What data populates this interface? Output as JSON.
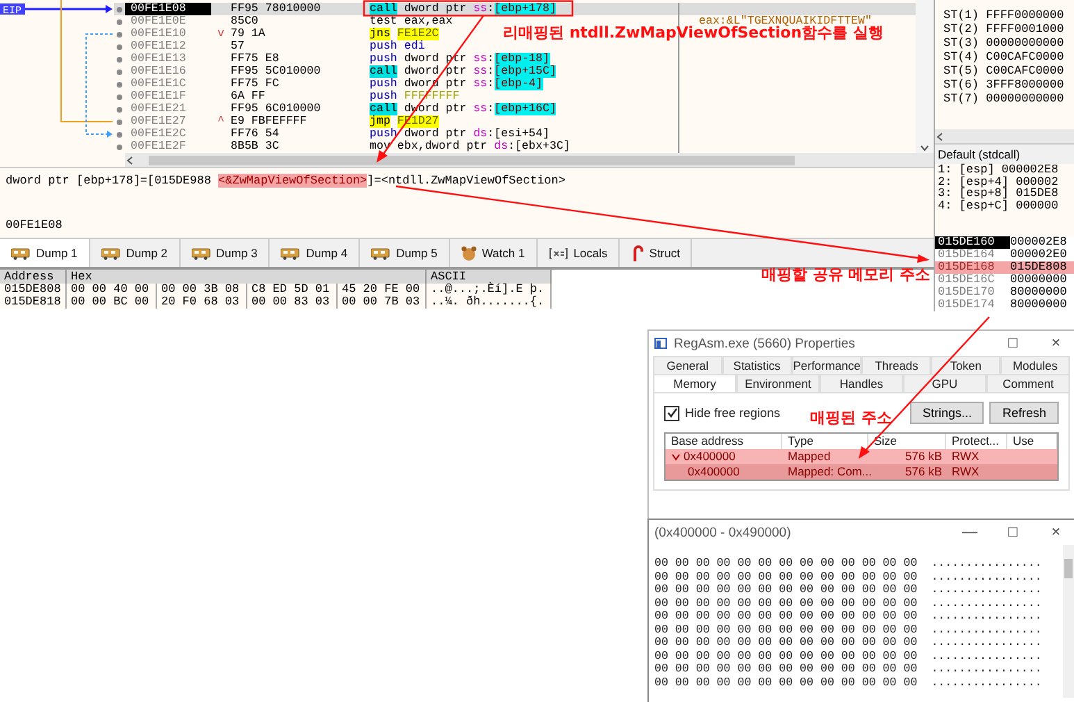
{
  "disassembly": {
    "eip_label": "EIP",
    "rows": [
      {
        "address": "00FE1E08",
        "marker": "",
        "bytes": "FF95 78010000",
        "selected": true,
        "comment": "",
        "instruction": [
          {
            "kind": "call",
            "text": "call"
          },
          {
            "kind": "text",
            "text": " dword ptr "
          },
          {
            "kind": "segment",
            "text": "ss"
          },
          {
            "kind": "text",
            "text": ":"
          },
          {
            "kind": "mem_hl",
            "text": "[ebp+178]"
          }
        ]
      },
      {
        "address": "00FE1E0E",
        "marker": "",
        "bytes": "85C0",
        "selected": false,
        "comment": "eax:&L\"TGEXNQUAIKIDFTTEW\"",
        "instruction": [
          {
            "kind": "text",
            "text": "test eax,eax"
          }
        ]
      },
      {
        "address": "00FE1E10",
        "marker": "v",
        "bytes": "79 1A",
        "selected": false,
        "comment": "",
        "instruction": [
          {
            "kind": "jump",
            "text": "jns"
          },
          {
            "kind": "target",
            "text": "FE1E2C"
          }
        ]
      },
      {
        "address": "00FE1E12",
        "marker": "",
        "bytes": "57",
        "selected": false,
        "comment": "",
        "instruction": [
          {
            "kind": "push",
            "text": "push"
          },
          {
            "kind": "push",
            "text": " edi"
          }
        ]
      },
      {
        "address": "00FE1E13",
        "marker": "",
        "bytes": "FF75 E8",
        "selected": false,
        "comment": "",
        "instruction": [
          {
            "kind": "push",
            "text": "push"
          },
          {
            "kind": "text",
            "text": " dword ptr "
          },
          {
            "kind": "segment",
            "text": "ss"
          },
          {
            "kind": "text",
            "text": ":"
          },
          {
            "kind": "mem_hl",
            "text": "[ebp-18]"
          }
        ]
      },
      {
        "address": "00FE1E16",
        "marker": "",
        "bytes": "FF95 5C010000",
        "selected": false,
        "comment": "",
        "instruction": [
          {
            "kind": "call",
            "text": "call"
          },
          {
            "kind": "text",
            "text": " dword ptr "
          },
          {
            "kind": "segment",
            "text": "ss"
          },
          {
            "kind": "text",
            "text": ":"
          },
          {
            "kind": "mem_hl",
            "text": "[ebp+15C]"
          }
        ]
      },
      {
        "address": "00FE1E1C",
        "marker": "",
        "bytes": "FF75 FC",
        "selected": false,
        "comment": "",
        "instruction": [
          {
            "kind": "push",
            "text": "push"
          },
          {
            "kind": "text",
            "text": " dword ptr "
          },
          {
            "kind": "segment",
            "text": "ss"
          },
          {
            "kind": "text",
            "text": ":"
          },
          {
            "kind": "mem_hl",
            "text": "[ebp-4]"
          }
        ]
      },
      {
        "address": "00FE1E1F",
        "marker": "",
        "bytes": "6A FF",
        "selected": false,
        "comment": "",
        "instruction": [
          {
            "kind": "push",
            "text": "push"
          },
          {
            "kind": "immediate",
            "text": "FFFFFFFF"
          }
        ]
      },
      {
        "address": "00FE1E21",
        "marker": "",
        "bytes": "FF95 6C010000",
        "selected": false,
        "comment": "",
        "instruction": [
          {
            "kind": "call",
            "text": "call"
          },
          {
            "kind": "text",
            "text": " dword ptr "
          },
          {
            "kind": "segment",
            "text": "ss"
          },
          {
            "kind": "text",
            "text": ":"
          },
          {
            "kind": "mem_hl",
            "text": "[ebp+16C]"
          }
        ]
      },
      {
        "address": "00FE1E27",
        "marker": "^",
        "bytes": "E9 FBFEFFFF",
        "selected": false,
        "comment": "",
        "instruction": [
          {
            "kind": "jump",
            "text": "jmp"
          },
          {
            "kind": "target",
            "text": "FE1D27"
          }
        ]
      },
      {
        "address": "00FE1E2C",
        "marker": "",
        "bytes": "FF76 54",
        "selected": false,
        "comment": "",
        "instruction": [
          {
            "kind": "push",
            "text": "push"
          },
          {
            "kind": "text",
            "text": " dword ptr "
          },
          {
            "kind": "segment",
            "text": "ds"
          },
          {
            "kind": "text",
            "text": ":[esi+54]"
          }
        ]
      },
      {
        "address": "00FE1E2F",
        "marker": "",
        "bytes": "8B5B 3C",
        "selected": false,
        "comment": "",
        "instruction": [
          {
            "kind": "text",
            "text": "mov ebx,dword ptr "
          },
          {
            "kind": "segment",
            "text": "ds"
          },
          {
            "kind": "text",
            "text": ":[ebx+3C]"
          }
        ]
      }
    ]
  },
  "fpu_registers": [
    {
      "name": "ST(1)",
      "value": "FFFF0000000"
    },
    {
      "name": "ST(2)",
      "value": "FFFF0001000"
    },
    {
      "name": "ST(3)",
      "value": "00000000000"
    },
    {
      "name": "ST(4)",
      "value": "C00CAFC0000"
    },
    {
      "name": "ST(5)",
      "value": "C00CAFC0000"
    },
    {
      "name": "ST(6)",
      "value": "3FFF8000000"
    },
    {
      "name": "ST(7)",
      "value": "00000000000"
    }
  ],
  "call_stack": {
    "convention": "Default (stdcall)",
    "rows": [
      "1: [esp] 000002E8",
      "2: [esp+4] 000002",
      "3: [esp+8] 015DE8",
      "4: [esp+C] 000000"
    ]
  },
  "info_panel": {
    "before": "dword ptr [ebp+178]=[015DE988 ",
    "highlight": "<&ZwMapViewOfSection>",
    "after": "]=<ntdll.ZwMapViewOfSection>",
    "address": "00FE1E08"
  },
  "dump_tabs": [
    {
      "kind": "dump",
      "label": "Dump 1",
      "selected": true
    },
    {
      "kind": "dump",
      "label": "Dump 2",
      "selected": false
    },
    {
      "kind": "dump",
      "label": "Dump 3",
      "selected": false
    },
    {
      "kind": "dump",
      "label": "Dump 4",
      "selected": false
    },
    {
      "kind": "dump",
      "label": "Dump 5",
      "selected": false
    },
    {
      "kind": "watch",
      "label": "Watch 1",
      "selected": false
    },
    {
      "kind": "locals",
      "label": "Locals",
      "selected": false
    },
    {
      "kind": "struct",
      "label": "Struct",
      "selected": false
    }
  ],
  "dump": {
    "columns": [
      "Address",
      "Hex",
      "ASCII"
    ],
    "rows": [
      {
        "address": "015DE808",
        "groups": [
          "00 00 40 00",
          "00 00 3B 08",
          "C8 ED 5D 01",
          "45 20 FE 00"
        ],
        "ascii": "..@...;.Èí].E þ."
      },
      {
        "address": "015DE818",
        "groups": [
          "00 00 BC 00",
          "20 F0 68 03",
          "00 00 83 03",
          "00 00 7B 03"
        ],
        "ascii": "..¼. ðh.......{."
      }
    ]
  },
  "stack": [
    {
      "address": "015DE160",
      "value": "000002E8",
      "selected": true,
      "highlighted": false
    },
    {
      "address": "015DE164",
      "value": "000002E0",
      "selected": false,
      "highlighted": false
    },
    {
      "address": "015DE168",
      "value": "015DE808",
      "selected": false,
      "highlighted": true
    },
    {
      "address": "015DE16C",
      "value": "00000000",
      "selected": false,
      "highlighted": false
    },
    {
      "address": "015DE170",
      "value": "80000000",
      "selected": false,
      "highlighted": false
    },
    {
      "address": "015DE174",
      "value": "80000000",
      "selected": false,
      "highlighted": false
    }
  ],
  "annotations": [
    "리매핑된 ntdll.ZwMapViewOfSection함수를 실행",
    "매핑할 공유 메모리 주소",
    "매핑된 주소"
  ],
  "properties_window": {
    "title": "RegAsm.exe (5660) Properties",
    "controls": [
      "□",
      "×"
    ],
    "tab_rows": [
      [
        {
          "label": "General",
          "selected": false
        },
        {
          "label": "Statistics",
          "selected": false
        },
        {
          "label": "Performance",
          "selected": false
        },
        {
          "label": "Threads",
          "selected": false
        },
        {
          "label": "Token",
          "selected": false
        },
        {
          "label": "Modules",
          "selected": false
        }
      ],
      [
        {
          "label": "Memory",
          "selected": true
        },
        {
          "label": "Environment",
          "selected": false
        },
        {
          "label": "Handles",
          "selected": false
        },
        {
          "label": "GPU",
          "selected": false
        },
        {
          "label": "Comment",
          "selected": false
        }
      ]
    ],
    "hide_free_regions": {
      "label": "Hide free regions",
      "checked": true
    },
    "buttons": [
      "Strings...",
      "Refresh"
    ],
    "columns": [
      "Base address",
      "Type",
      "Size",
      "Protect...",
      "Use"
    ],
    "rows": [
      {
        "expanded": true,
        "selected": false,
        "cells": [
          "0x400000",
          "Mapped",
          "576 kB",
          "RWX"
        ],
        "children": [
          {
            "selected": true,
            "cells": [
              "0x400000",
              "Mapped: Com...",
              "576 kB",
              "RWX"
            ]
          }
        ]
      }
    ]
  },
  "memory_window": {
    "title": "(0x400000 - 0x490000)",
    "controls": [
      "—",
      "□",
      "×"
    ],
    "rows": [
      {
        "hex": "00 00 00 00 00 00 00 00 00 00 00 00 00",
        "ascii": "................"
      },
      {
        "hex": "00 00 00 00 00 00 00 00 00 00 00 00 00",
        "ascii": "................"
      },
      {
        "hex": "00 00 00 00 00 00 00 00 00 00 00 00 00",
        "ascii": "................"
      },
      {
        "hex": "00 00 00 00 00 00 00 00 00 00 00 00 00",
        "ascii": "................"
      },
      {
        "hex": "00 00 00 00 00 00 00 00 00 00 00 00 00",
        "ascii": "................"
      },
      {
        "hex": "00 00 00 00 00 00 00 00 00 00 00 00 00",
        "ascii": "................"
      },
      {
        "hex": "00 00 00 00 00 00 00 00 00 00 00 00 00",
        "ascii": "................"
      },
      {
        "hex": "00 00 00 00 00 00 00 00 00 00 00 00 00",
        "ascii": "................"
      },
      {
        "hex": "00 00 00 00 00 00 00 00 00 00 00 00 00",
        "ascii": "................"
      },
      {
        "hex": "00 00 00 00 00 00 00 00 00 00 00 00 00",
        "ascii": "................"
      }
    ]
  }
}
